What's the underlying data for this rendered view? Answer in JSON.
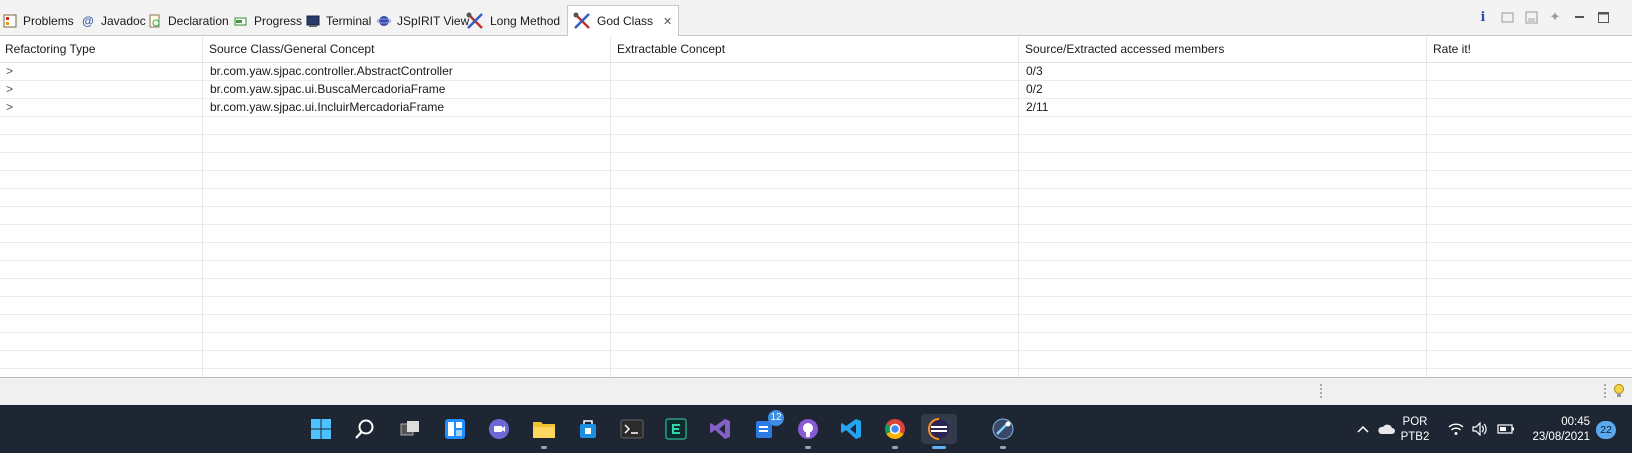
{
  "tabs": [
    {
      "label": "Problems",
      "icon": "problems-icon"
    },
    {
      "label": "Javadoc",
      "icon": "javadoc-icon"
    },
    {
      "label": "Declaration",
      "icon": "declaration-icon"
    },
    {
      "label": "Progress",
      "icon": "progress-icon"
    },
    {
      "label": "Terminal",
      "icon": "terminal-icon"
    },
    {
      "label": "JSpIRIT View",
      "icon": "jspirit-icon"
    },
    {
      "label": "Long Method",
      "icon": "tools-icon"
    },
    {
      "label": "God Class",
      "icon": "tools-icon",
      "active": true
    }
  ],
  "view_tools": [
    "info-icon",
    "restore-icon",
    "save-icon",
    "pin-icon",
    "minimize-icon",
    "maximize-icon"
  ],
  "table": {
    "columns": [
      "Refactoring Type",
      "Source Class/General Concept",
      "Extractable Concept",
      "Source/Extracted accessed members",
      "Rate it!"
    ],
    "rows": [
      {
        "expander": ">",
        "source": "br.com.yaw.sjpac.controller.AbstractController",
        "extractable": "",
        "members": "0/3",
        "rate": ""
      },
      {
        "expander": ">",
        "source": "br.com.yaw.sjpac.ui.BuscaMercadoriaFrame",
        "extractable": "",
        "members": "0/2",
        "rate": ""
      },
      {
        "expander": ">",
        "source": "br.com.yaw.sjpac.ui.IncluirMercadoriaFrame",
        "extractable": "",
        "members": "2/11",
        "rate": ""
      }
    ]
  },
  "taskbar": {
    "apps": [
      "windows-start-icon",
      "search-icon",
      "task-view-icon",
      "widgets-icon",
      "teams-chat-icon",
      "file-explorer-icon",
      "store-icon",
      "terminal-icon",
      "editor-icon",
      "visual-studio-icon",
      "todo-icon",
      "github-desktop-icon",
      "vscode-icon",
      "chrome-icon",
      "eclipse-icon",
      "eclipse-alt-icon"
    ],
    "todo_badge": "12",
    "tray": {
      "lang_line1": "POR",
      "lang_line2": "PTB2",
      "time": "00:45",
      "date": "23/08/2021",
      "notifications": "22"
    }
  },
  "colors": {
    "accent": "#5fb3f3",
    "taskbar": "#1f2633"
  }
}
